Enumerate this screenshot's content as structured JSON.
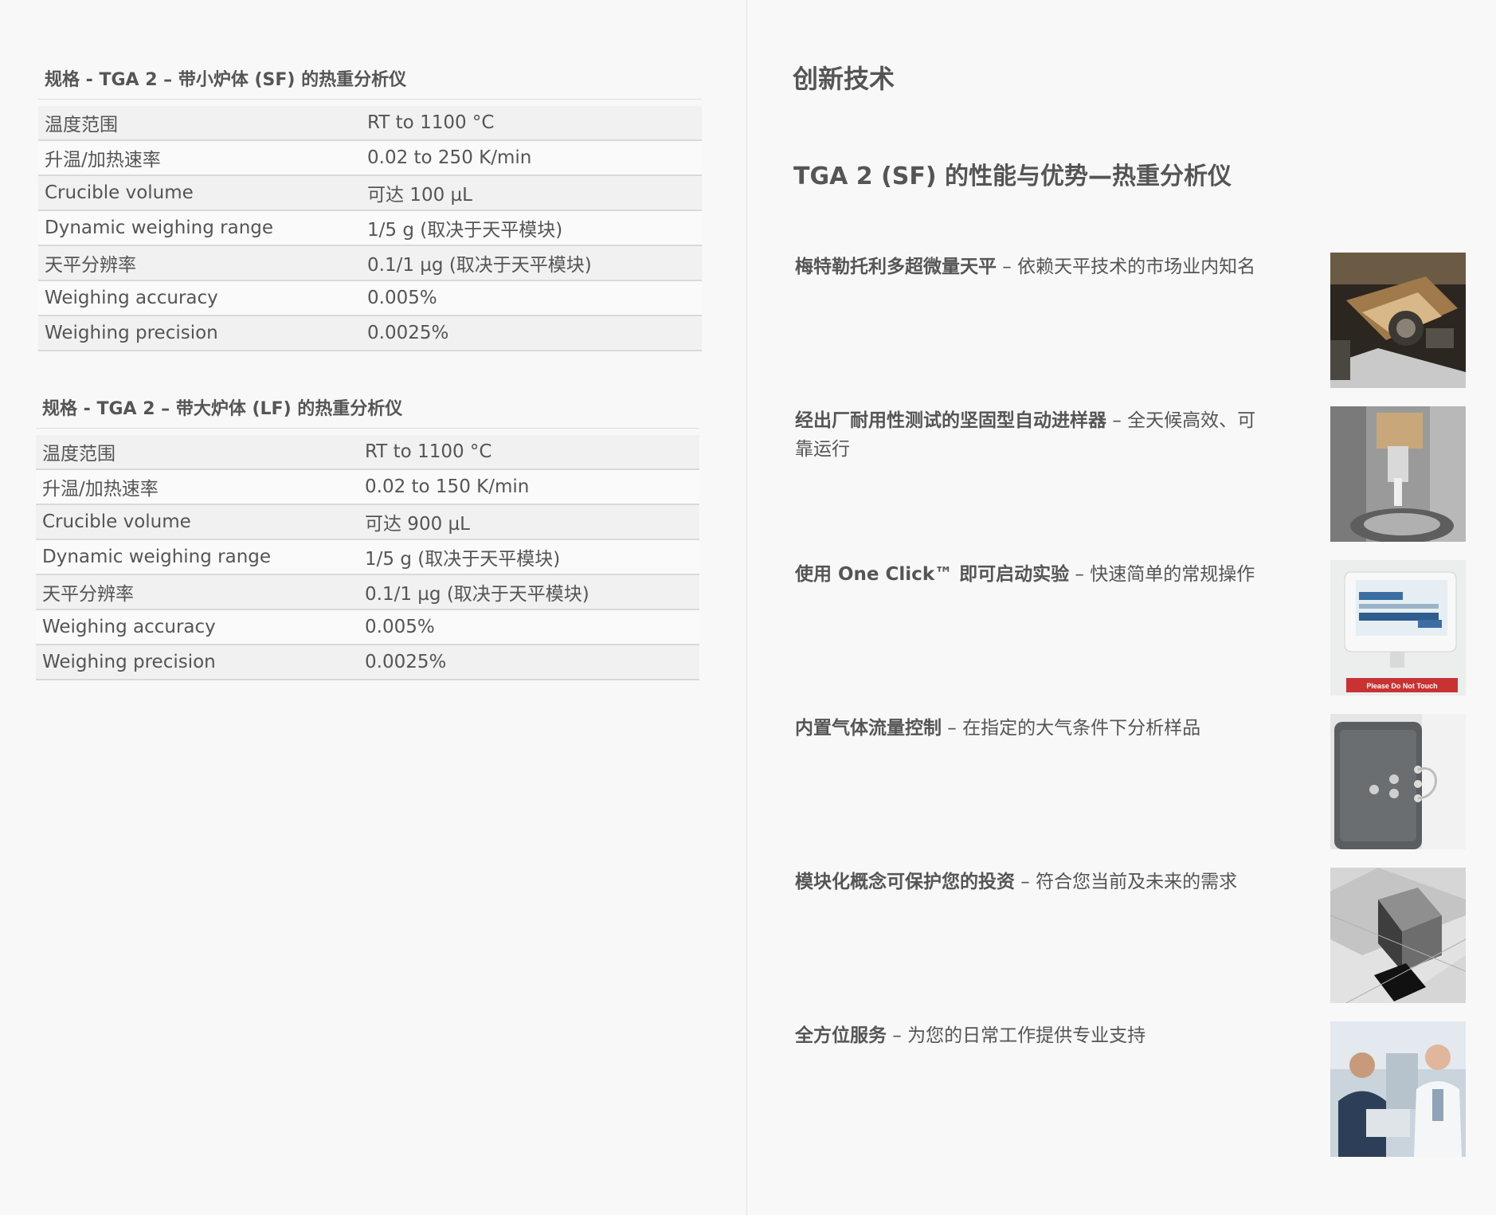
{
  "spec_sf": {
    "title": "规格 - TGA 2 – 带小炉体 (SF) 的热重分析仪",
    "rows": [
      {
        "label": "温度范围",
        "value": "RT to 1100 °C"
      },
      {
        "label": "升温/加热速率",
        "value": "0.02 to 250 K/min"
      },
      {
        "label": "Crucible volume",
        "value": "可达 100 µL"
      },
      {
        "label": "Dynamic weighing range",
        "value": "1/5 g (取决于天平模块)"
      },
      {
        "label": "天平分辨率",
        "value": "0.1/1 µg (取决于天平模块)"
      },
      {
        "label": "Weighing accuracy",
        "value": "0.005%"
      },
      {
        "label": "Weighing precision",
        "value": "0.0025%"
      }
    ]
  },
  "spec_lf": {
    "title": "规格 - TGA 2 – 带大炉体 (LF) 的热重分析仪",
    "rows": [
      {
        "label": "温度范围",
        "value": "RT to 1100 °C"
      },
      {
        "label": "升温/加热速率",
        "value": "0.02 to 150 K/min"
      },
      {
        "label": "Crucible volume",
        "value": "可达 900 µL"
      },
      {
        "label": "Dynamic weighing range",
        "value": "1/5 g (取决于天平模块)"
      },
      {
        "label": "天平分辨率",
        "value": "0.1/1 µg (取决于天平模块)"
      },
      {
        "label": "Weighing accuracy",
        "value": "0.005%"
      },
      {
        "label": "Weighing precision",
        "value": "0.0025%"
      }
    ]
  },
  "innovation": {
    "heading": "创新技术",
    "subheading": "TGA 2 (SF) 的性能与优势—热重分析仪",
    "features": [
      {
        "bold": "梅特勒托利多超微量天平",
        "rest": " – 依赖天平技术的市场业内知名"
      },
      {
        "bold": "经出厂耐用性测试的坚固型自动进样器",
        "rest": " – 全天候高效、可靠运行"
      },
      {
        "bold": "使用 One Click™ 即可启动实验",
        "rest": " – 快速简单的常规操作",
        "screen_label": "Please Do Not Touch"
      },
      {
        "bold": "内置气体流量控制",
        "rest": " – 在指定的大气条件下分析样品"
      },
      {
        "bold": "模块化概念可保护您的投资",
        "rest": " – 符合您当前及未来的需求"
      },
      {
        "bold": "全方位服务",
        "rest": " – 为您的日常工作提供专业支持"
      }
    ]
  },
  "thumbnails": [
    "balance-photo",
    "autosampler-photo",
    "touchscreen-terminal-photo",
    "gas-controller-photo",
    "modular-cubes-photo",
    "service-engineers-photo"
  ]
}
